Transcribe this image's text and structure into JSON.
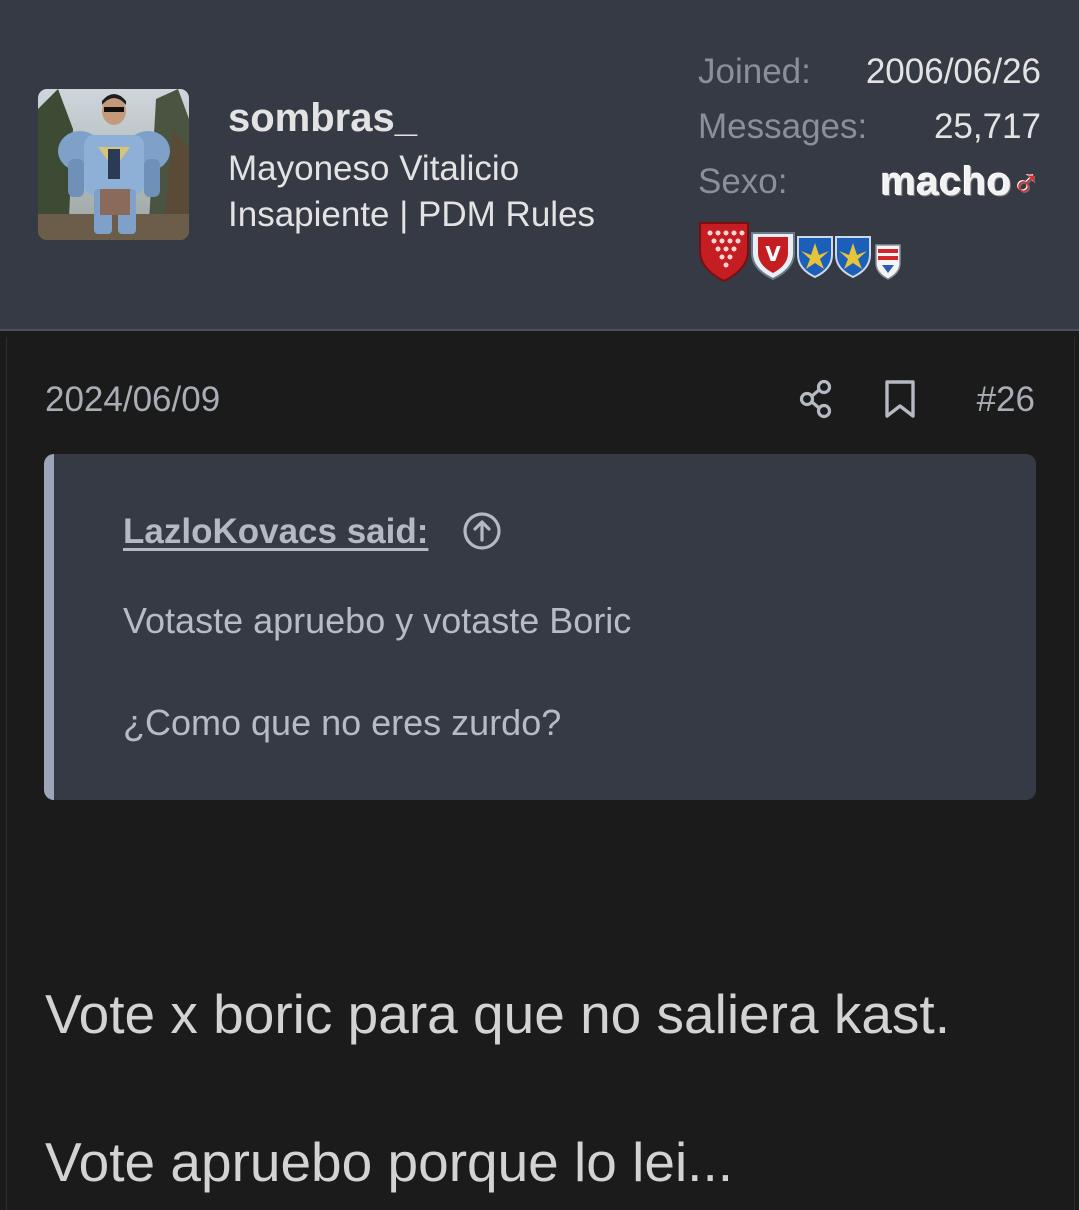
{
  "user": {
    "avatar_alt": "avatar",
    "name": "sombras_",
    "title_line1": "Mayoneso Vitalicio",
    "title_line2": "Insapiente | PDM Rules",
    "stats": {
      "joined_label": "Joined:",
      "joined_value": "2006/06/26",
      "messages_label": "Messages:",
      "messages_value": "25,717",
      "gender_label": "Sexo:",
      "gender_value": "macho",
      "gender_symbol": "♂"
    },
    "badges": [
      "red-shield-badge",
      "red-v-badge",
      "blue-fleur-badge",
      "blue-fleur-badge",
      "striped-badge"
    ]
  },
  "post": {
    "date": "2024/06/09",
    "number": "#26",
    "icons": {
      "share": "share-icon",
      "bookmark": "bookmark-icon"
    },
    "quote": {
      "author": "LazloKovacs said:",
      "lines": [
        "Votaste apruebo y votaste Boric",
        "¿Como que no eres zurdo?"
      ]
    },
    "body_lines": [
      "Vote x boric para que no saliera kast.",
      "Vote apruebo porque lo lei..."
    ]
  },
  "colors": {
    "header_bg": "#363a44",
    "page_bg": "#1b1b1c",
    "quote_bg": "#363a44",
    "quote_border": "#9da5b9",
    "gender_accent": "#e5262a"
  }
}
